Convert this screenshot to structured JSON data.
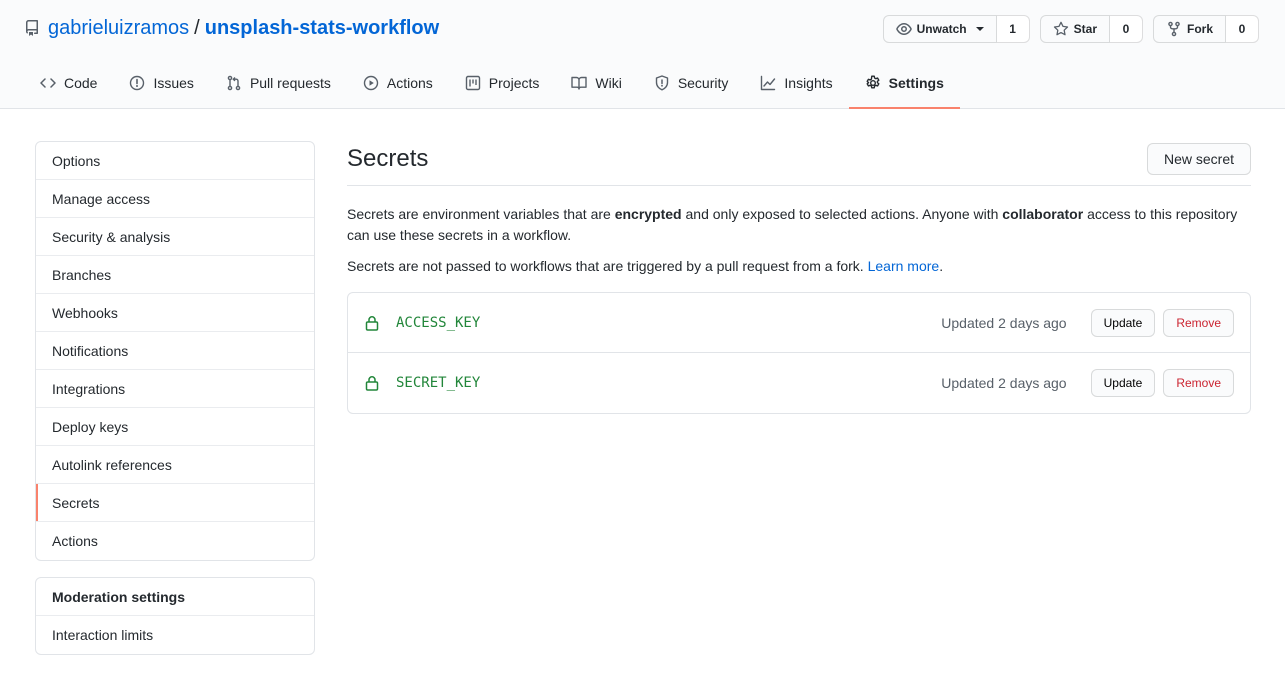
{
  "repo": {
    "owner": "gabrieluizramos",
    "separator": "/",
    "name": "unsplash-stats-workflow"
  },
  "actions": {
    "unwatch": {
      "label": "Unwatch",
      "count": "1"
    },
    "star": {
      "label": "Star",
      "count": "0"
    },
    "fork": {
      "label": "Fork",
      "count": "0"
    }
  },
  "tabs": [
    {
      "label": "Code",
      "icon": "code-icon"
    },
    {
      "label": "Issues",
      "icon": "issue-icon"
    },
    {
      "label": "Pull requests",
      "icon": "pull-request-icon"
    },
    {
      "label": "Actions",
      "icon": "play-icon"
    },
    {
      "label": "Projects",
      "icon": "project-icon"
    },
    {
      "label": "Wiki",
      "icon": "book-icon"
    },
    {
      "label": "Security",
      "icon": "shield-icon"
    },
    {
      "label": "Insights",
      "icon": "graph-icon"
    },
    {
      "label": "Settings",
      "icon": "gear-icon",
      "selected": true
    }
  ],
  "sidebar": {
    "items": [
      "Options",
      "Manage access",
      "Security & analysis",
      "Branches",
      "Webhooks",
      "Notifications",
      "Integrations",
      "Deploy keys",
      "Autolink references",
      "Secrets",
      "Actions"
    ],
    "selected": "Secrets",
    "moderation_heading": "Moderation settings",
    "moderation_items": [
      "Interaction limits"
    ]
  },
  "main": {
    "title": "Secrets",
    "new_button": "New secret",
    "desc1_a": "Secrets are environment variables that are ",
    "desc1_b": "encrypted",
    "desc1_c": " and only exposed to selected actions. Anyone with ",
    "desc1_d": "collaborator",
    "desc1_e": " access to this repository can use these secrets in a workflow.",
    "desc2_a": "Secrets are not passed to workflows that are triggered by a pull request from a fork. ",
    "desc2_link": "Learn more",
    "desc2_end": ".",
    "secrets": [
      {
        "name": "ACCESS_KEY",
        "updated": "Updated 2 days ago",
        "update": "Update",
        "remove": "Remove"
      },
      {
        "name": "SECRET_KEY",
        "updated": "Updated 2 days ago",
        "update": "Update",
        "remove": "Remove"
      }
    ]
  },
  "colors": {
    "accent": "#f9826c",
    "link": "#0366d6",
    "secret": "#22863a",
    "danger": "#cb2431"
  }
}
